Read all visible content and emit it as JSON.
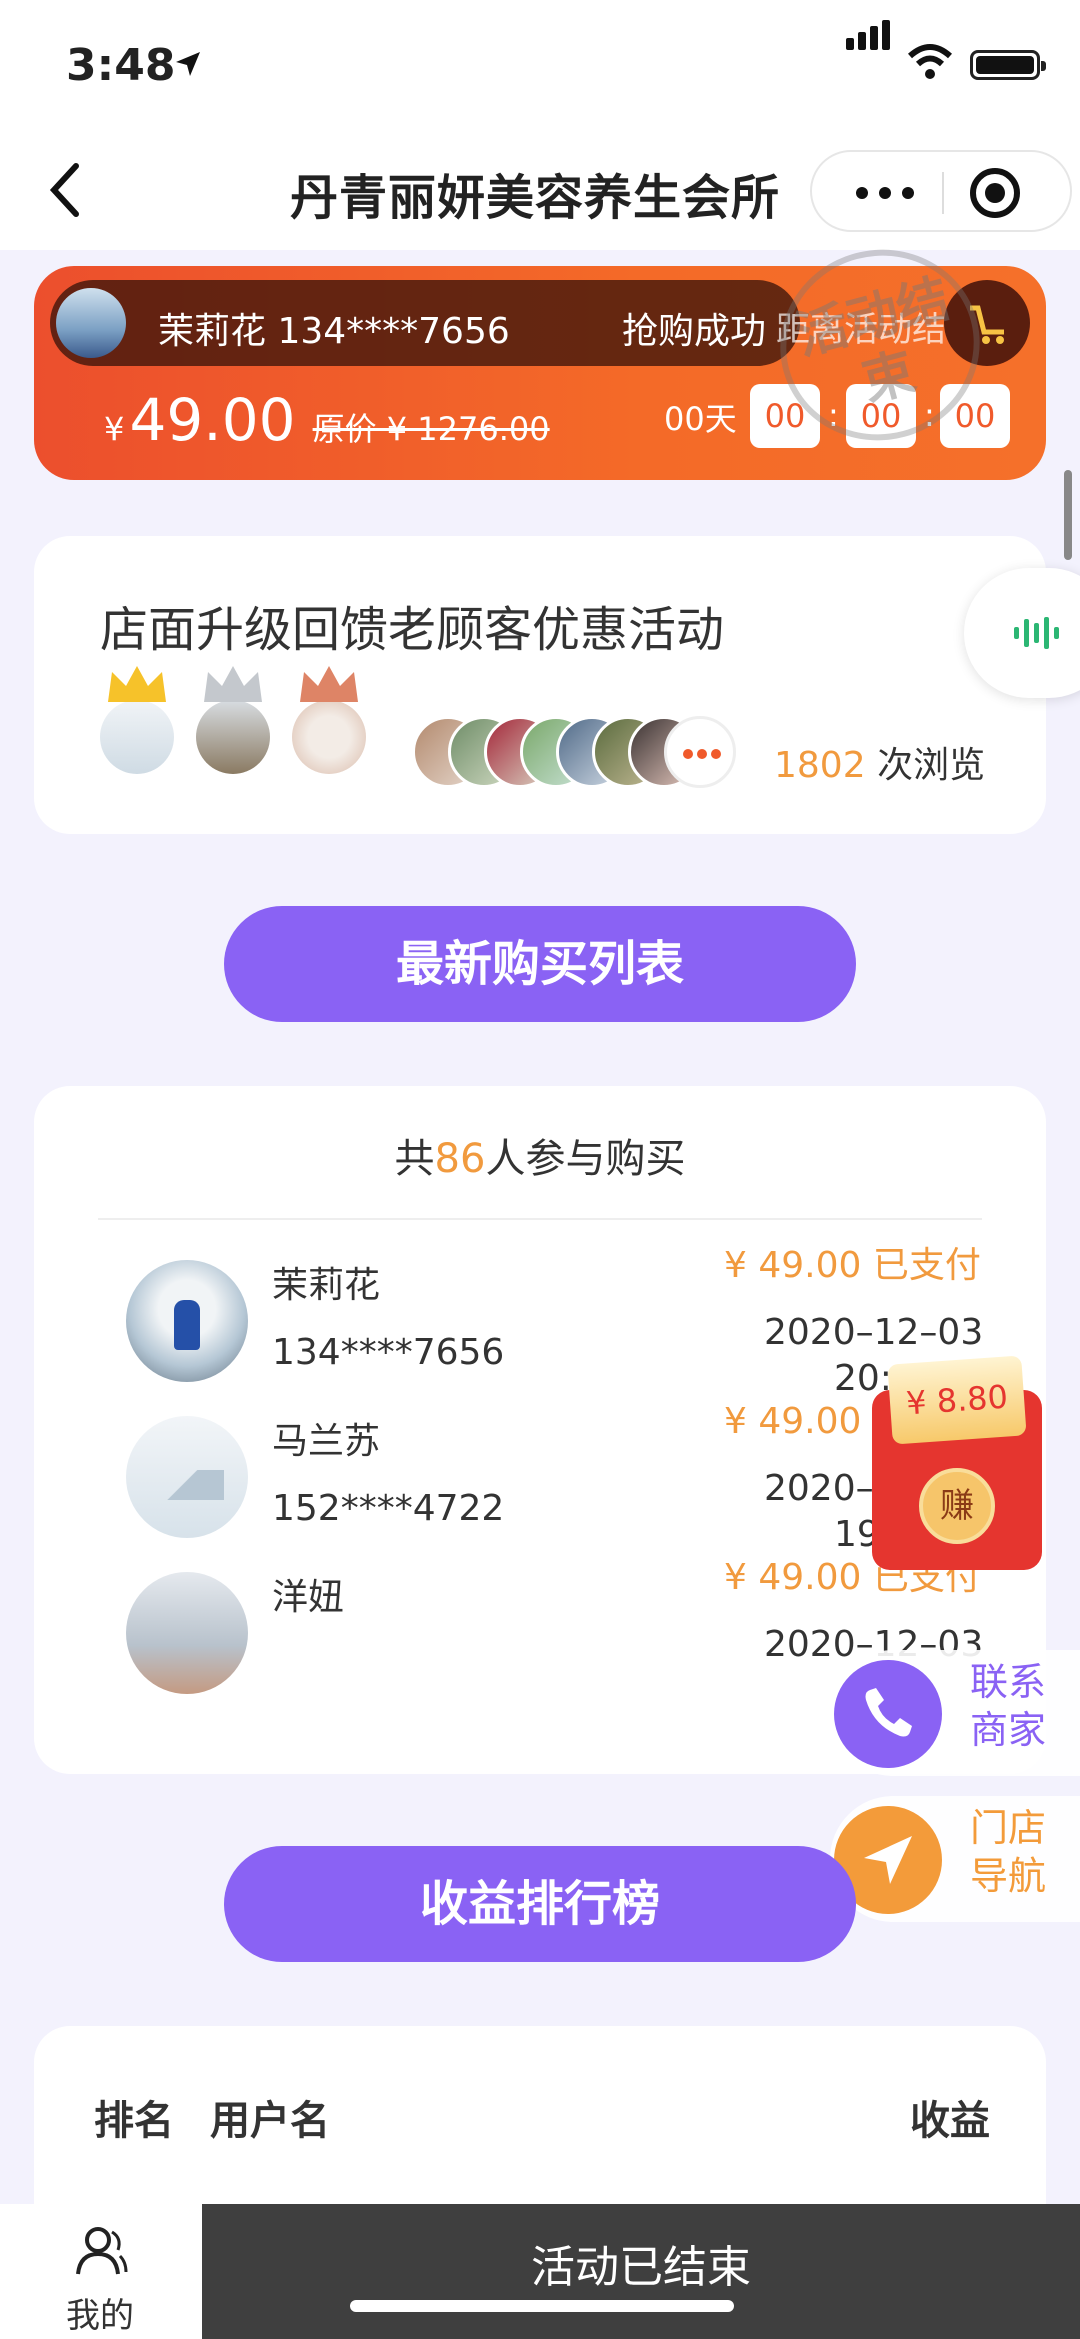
{
  "status": {
    "time": "3:48"
  },
  "nav": {
    "title": "丹青丽妍美容养生会所"
  },
  "banner": {
    "ticker_name": "茉莉花 134****7656",
    "ticker_status": "抢购成功",
    "end_text": "距离活动结",
    "currency": "¥",
    "price": "49.00",
    "original_price": "原价 ¥ 1276.00",
    "countdown": {
      "days": "00天",
      "hours": "00",
      "minutes": "00",
      "seconds": "00",
      "separator": ":"
    },
    "stamp_text": "活动结束"
  },
  "activity": {
    "title": "店面升级回馈老顾客优惠活动",
    "views_count": "1802",
    "views_label": "次浏览"
  },
  "buttons": {
    "latest_purchases": "最新购买列表",
    "earnings_ranking": "收益排行榜"
  },
  "buyers": {
    "head_prefix": "共",
    "count": "86",
    "head_suffix": "人参与购买",
    "rows": [
      {
        "name": "茉莉花",
        "phone": "134****7656",
        "amount": "¥ 49.00 已支付",
        "date": "2020–12–03",
        "time": "20:"
      },
      {
        "name": "马兰苏",
        "phone": "152****4722",
        "amount": "¥ 49.00 已支付",
        "date": "2020–12–03",
        "time": "19:29:00"
      },
      {
        "name": "洋妞",
        "phone": "",
        "amount": "¥ 49.00 已支付",
        "date": "2020–12–03",
        "time": ""
      }
    ]
  },
  "envelope": {
    "amount": "¥ 8.80",
    "coin": "赚"
  },
  "side_actions": {
    "contact": "联系商家",
    "navigate": "门店导航"
  },
  "ranking": {
    "col_rank": "排名",
    "col_user": "用户名",
    "col_earnings": "收益"
  },
  "bottom": {
    "my_tab": "我的",
    "ended": "活动已结束"
  }
}
